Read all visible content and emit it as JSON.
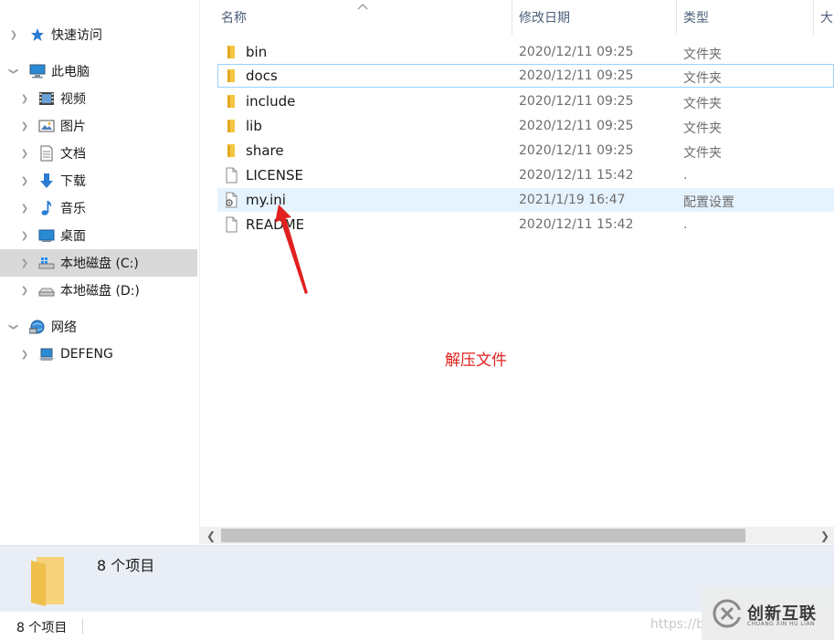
{
  "nav": {
    "items": [
      {
        "label": "快速访问",
        "icon": "star-icon"
      },
      {
        "label": "此电脑",
        "icon": "computer-icon"
      },
      {
        "label": "视频",
        "icon": "video-icon"
      },
      {
        "label": "图片",
        "icon": "pictures-icon"
      },
      {
        "label": "文档",
        "icon": "documents-icon"
      },
      {
        "label": "下载",
        "icon": "download-icon"
      },
      {
        "label": "音乐",
        "icon": "music-icon"
      },
      {
        "label": "桌面",
        "icon": "desktop-icon"
      },
      {
        "label": "本地磁盘 (C:)",
        "icon": "drive-c-icon"
      },
      {
        "label": "本地磁盘 (D:)",
        "icon": "drive-d-icon"
      },
      {
        "label": "网络",
        "icon": "network-icon"
      },
      {
        "label": "DEFENG",
        "icon": "network-computer-icon"
      }
    ],
    "selected": "本地磁盘 (C:)"
  },
  "columns": {
    "name": "名称",
    "date": "修改日期",
    "type": "类型",
    "size": "大"
  },
  "files": [
    {
      "name": "bin",
      "date": "2020/12/11 09:25",
      "type": "文件夹",
      "icon": "folder-icon"
    },
    {
      "name": "docs",
      "date": "2020/12/11 09:25",
      "type": "文件夹",
      "icon": "folder-icon"
    },
    {
      "name": "include",
      "date": "2020/12/11 09:25",
      "type": "文件夹",
      "icon": "folder-icon"
    },
    {
      "name": "lib",
      "date": "2020/12/11 09:25",
      "type": "文件夹",
      "icon": "folder-icon"
    },
    {
      "name": "share",
      "date": "2020/12/11 09:25",
      "type": "文件夹",
      "icon": "folder-icon"
    },
    {
      "name": "LICENSE",
      "date": "2020/12/11 15:42",
      "type": ".",
      "icon": "file-icon"
    },
    {
      "name": "my.ini",
      "date": "2021/1/19 16:47",
      "type": "配置设置",
      "icon": "settings-file-icon"
    },
    {
      "name": "README",
      "date": "2020/12/11 15:42",
      "type": ".",
      "icon": "file-icon"
    }
  ],
  "annotation": "解压文件",
  "details": {
    "count": "8 个项目"
  },
  "status": {
    "count": "8 个项目",
    "watermark": "https://b"
  },
  "logo": {
    "cn": "创新互联",
    "en": "CHUANG XIN HU LIAN"
  },
  "colors": {
    "folder": "#f5c542",
    "selection": "#d9d9d9",
    "hover": "#e5f3ff",
    "annotation": "#e0211f",
    "details_bg": "#e9eef6"
  }
}
